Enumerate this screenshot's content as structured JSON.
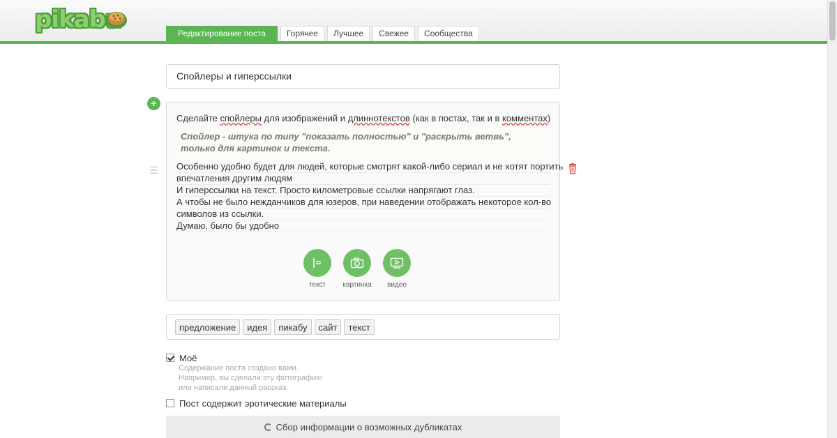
{
  "header": {
    "logo_text": "pikabu",
    "tabs": [
      {
        "label": "Редактирование поста",
        "active": true
      },
      {
        "label": "Горячее"
      },
      {
        "label": "Лучшее"
      },
      {
        "label": "Свежее"
      },
      {
        "label": "Сообщества"
      }
    ],
    "accent_color": "#5ab552"
  },
  "post": {
    "title": "Спойлеры и гиперссылки",
    "intro_parts": [
      "Сделайте ",
      "спойлеры",
      " для изображений и ",
      "длиннотекстов",
      " (как в постах, так и в ",
      "комментах",
      ")"
    ],
    "quote": "Спойлер - штука по типу \"показать полностью\" и \"раскрыть ветвь\", только для картинок и текста.",
    "lines": [
      "Особенно удобно будет для людей, которые смотрят какой-либо сериал и не хотят портить",
      "впечатления другим людям",
      "И гиперссылки на текст. Просто километровые ссылки напрягают глаз.",
      "А чтобы не было нежданчиков для юзеров, при наведении отображать некоторое кол-во",
      "символов из ссылки.",
      "Думаю, было бы удобно"
    ]
  },
  "media_buttons": [
    {
      "label": "текст",
      "icon": "text-icon"
    },
    {
      "label": "картинка",
      "icon": "camera-icon"
    },
    {
      "label": "видео",
      "icon": "video-icon"
    }
  ],
  "tags": [
    "предложение",
    "идея",
    "пикабу",
    "сайт",
    "текст"
  ],
  "options": {
    "mine_label": "Моё",
    "mine_checked": true,
    "mine_desc": [
      "Содержание поста создано вами.",
      "Например, вы сделали эту фотографию",
      "или написали данный рассказ."
    ],
    "erotic_label": "Пост содержит эротические материалы",
    "erotic_checked": false
  },
  "duplicates_text": "Сбор информации о возможных дубликатах"
}
